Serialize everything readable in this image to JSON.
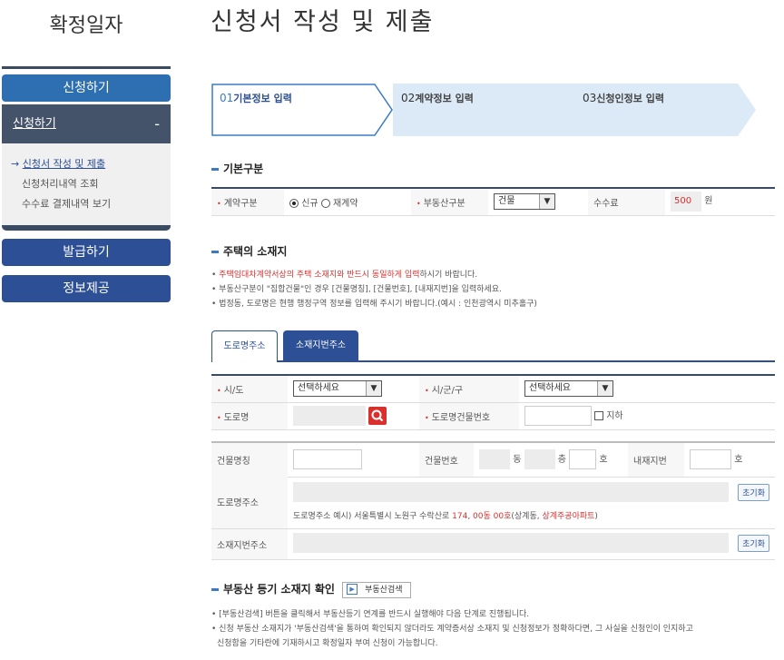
{
  "sidebar": {
    "title": "확정일자",
    "menu_apply": "신청하기",
    "sub_head": "신청하기",
    "sub_head_toggle": "-",
    "sub_items": [
      {
        "label": "신청서 작성 및 제출",
        "active": true
      },
      {
        "label": "신청처리내역 조회",
        "active": false
      },
      {
        "label": "수수료 결제내역 보기",
        "active": false
      }
    ],
    "menu_issue": "발급하기",
    "menu_info": "정보제공"
  },
  "page": {
    "title": "신청서 작성 및 제출"
  },
  "steps": [
    {
      "num": "01",
      "label": "기본정보 입력",
      "active": true
    },
    {
      "num": "02",
      "label": "계약정보 입력",
      "active": false
    },
    {
      "num": "03",
      "label": "신청인정보 입력",
      "active": false
    }
  ],
  "basic": {
    "section_title": "기본구분",
    "contract_type_label": "계약구분",
    "contract_new": "신규",
    "contract_renew": "재계약",
    "property_type_label": "부동산구분",
    "property_type_value": "건물",
    "fee_label": "수수료",
    "fee_value": "500",
    "fee_unit": "원"
  },
  "address": {
    "section_title": "주택의 소재지",
    "notes": [
      {
        "red": "주택임대차계약서상의 주택 소재지와 반드시 동일하게 입력",
        "rest": "하시기 바랍니다."
      },
      {
        "red": "",
        "rest": "부동산구분이 \"집합건물\"인 경우 [건물명칭], [건물번호], [내재지번]을 입력하세요."
      },
      {
        "red": "",
        "rest": "법정동, 도로명은 현행 행정구역 정보를 입력해 주시기 바랍니다.(예시 : 인천광역시 미추홀구)"
      }
    ],
    "tab_road": "도로명주소",
    "tab_lot": "소재지번주소",
    "sido_label": "시/도",
    "sido_value": "선택하세요",
    "sigungu_label": "시/군/구",
    "sigungu_value": "선택하세요",
    "road_label": "도로명",
    "road_bldg_no_label": "도로명건물번호",
    "basement_label": "지하",
    "bldg_name_label": "건물명칭",
    "bldg_no_label": "건물번호",
    "dong_unit": "동",
    "floor_unit": "층",
    "ho_unit": "호",
    "inner_lot_label": "내재지번",
    "ho_unit2": "호",
    "road_addr_label": "도로명주소",
    "reset_label": "초기화",
    "example_prefix": "도로명주소 예시) 서울특별시 노원구 수락산로 ",
    "example_red1": "174, 00동 00호",
    "example_mid": "(상계동, ",
    "example_red2": "상계주공아파트",
    "example_suffix": ")",
    "lot_addr_label": "소재지번주소",
    "reset_label2": "초기화"
  },
  "registry": {
    "section_title": "부동산 등기 소재지 확인",
    "search_btn": "부동산검색",
    "notes": [
      "[부동산검색] 버튼을 클릭해서 부동산등기 연계를 반드시 실행해야 다음 단계로 진행됩니다.",
      "신청 부동산 소재지가 '부동산검색'을 통하여 확인되지 않더라도 계약증서상 소재지 및 신청정보가 정확하다면, 그 사실을 신청인이 인지하고",
      "신청함을 기타란에 기재하시고 확정일자 부여 신청이 가능합니다."
    ]
  }
}
